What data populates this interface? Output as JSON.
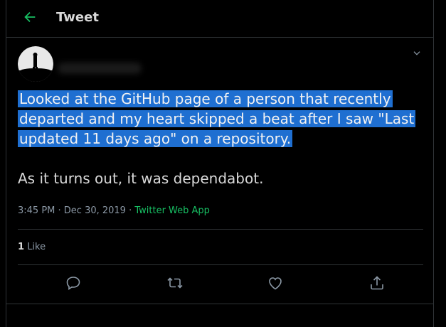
{
  "header": {
    "title": "Tweet",
    "back_icon": "back-arrow-icon",
    "accent": "#17bf63"
  },
  "tweet": {
    "paragraph1": "Looked at the GitHub page of a person that recently departed and my heart skipped a beat after I saw \"Last updated 11 days ago\" on a repository.",
    "paragraph2": "As it turns out, it was dependabot.",
    "time": "3:45 PM · Dec 30, 2019 · ",
    "source": "Twitter Web App",
    "likes_count": "1",
    "likes_label": "Like"
  },
  "icons": {
    "reply": "reply-icon",
    "retweet": "retweet-icon",
    "like": "like-icon",
    "share": "share-icon",
    "menu": "chevron-down-icon"
  },
  "colors": {
    "highlight": "#1f6fd1",
    "divider": "#2f3336",
    "muted": "#8b98a5"
  }
}
